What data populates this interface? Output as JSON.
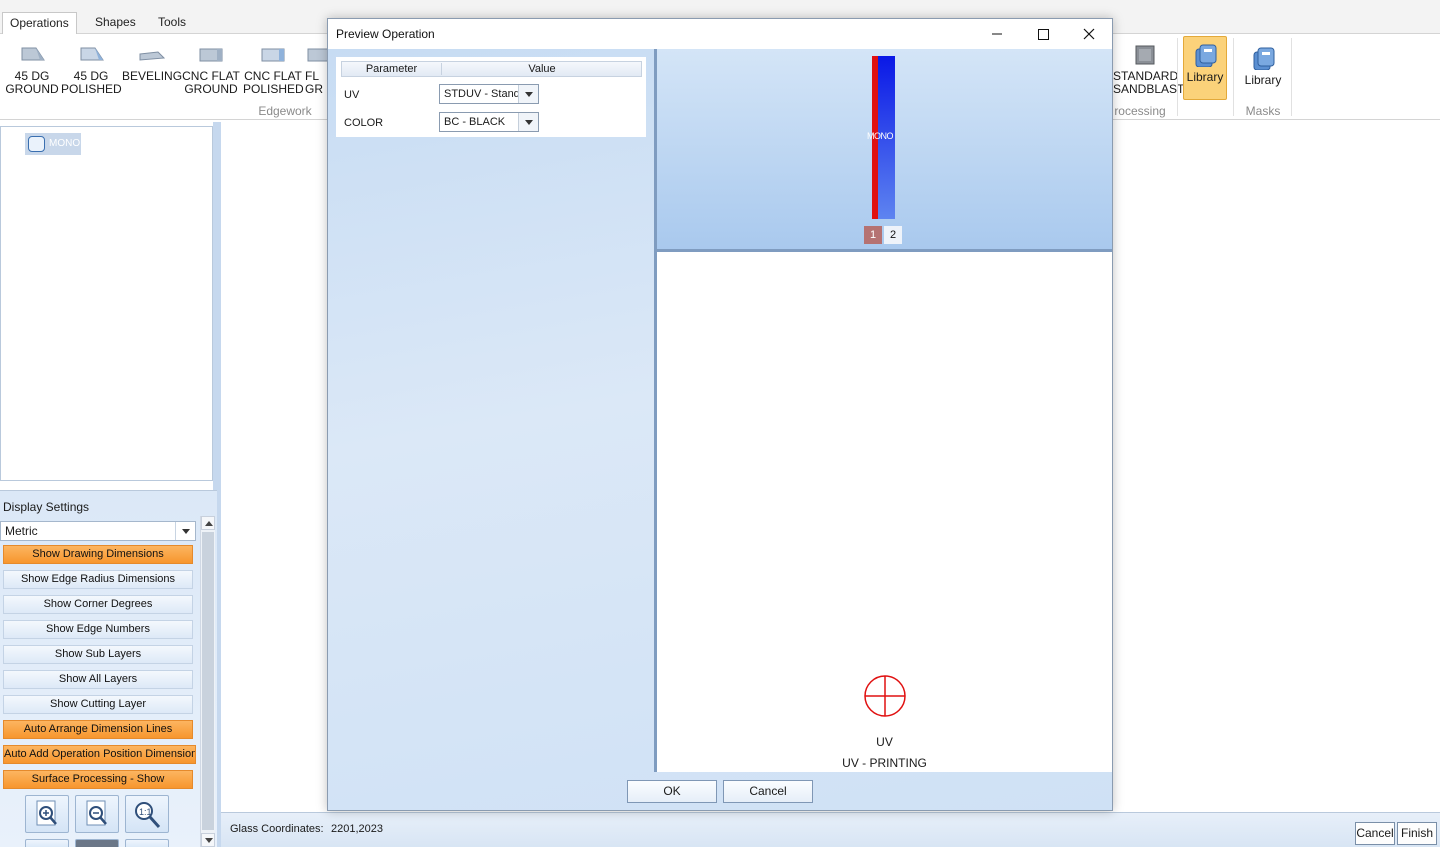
{
  "ribbon": {
    "tabs": [
      {
        "label": "Operations",
        "active": true
      },
      {
        "label": "Shapes",
        "active": false
      },
      {
        "label": "Tools",
        "active": false
      }
    ],
    "buttons": [
      {
        "line1": "45 DG",
        "line2": "GROUND",
        "icon": "edge-45-icon"
      },
      {
        "line1": "45 DG",
        "line2": "POLISHED",
        "icon": "edge-45-polished-icon"
      },
      {
        "line1": "BEVELING",
        "line2": "",
        "icon": "bevel-icon"
      },
      {
        "line1": "CNC FLAT",
        "line2": "GROUND",
        "icon": "cnc-flat-icon"
      },
      {
        "line1": "CNC FLAT",
        "line2": "POLISHED",
        "icon": "cnc-flat-polished-icon"
      },
      {
        "line1": "FL",
        "line2": "GR",
        "icon": "flat-icon"
      }
    ],
    "right_buttons": [
      {
        "line1": "STANDARD",
        "line2": "SANDBLAST",
        "icon": "sandblast-icon"
      },
      {
        "line1": "Library",
        "line2": "",
        "icon": "library-icon",
        "selected": true
      },
      {
        "line1": "Library",
        "line2": "",
        "icon": "library-icon"
      }
    ],
    "groups": {
      "edgework": "Edgework",
      "processing": "rocessing",
      "masks": "Masks"
    }
  },
  "layer_tree": {
    "node_label": "MONO"
  },
  "display_settings": {
    "title": "Display Settings",
    "units": "Metric",
    "toggles": [
      {
        "label": "Show Drawing Dimensions",
        "on": true
      },
      {
        "label": "Show Edge Radius Dimensions",
        "on": false
      },
      {
        "label": "Show Corner Degrees",
        "on": false
      },
      {
        "label": "Show Edge Numbers",
        "on": false
      },
      {
        "label": "Show Sub Layers",
        "on": false
      },
      {
        "label": "Show All Layers",
        "on": false
      },
      {
        "label": "Show Cutting Layer",
        "on": false
      },
      {
        "label": "Auto Arrange Dimension Lines",
        "on": true
      },
      {
        "label": "Auto Add Operation Position Dimension",
        "on": true
      },
      {
        "label": "Surface Processing - Show",
        "on": true
      }
    ],
    "zoom_buttons": [
      "zoom-in-icon",
      "zoom-out-icon",
      "zoom-actual-icon"
    ]
  },
  "status_bar": {
    "coord_label": "Glass Coordinates:",
    "coord_value": "2201,2023",
    "cancel_label": "Cancel",
    "finish_label": "Finish"
  },
  "dialog": {
    "title": "Preview Operation",
    "table_header": {
      "param": "Parameter",
      "value": "Value"
    },
    "rows": [
      {
        "param": "UV",
        "value": "STDUV - Standard"
      },
      {
        "param": "COLOR",
        "value": "BC - BLACK"
      }
    ],
    "bar_label": "MONO",
    "edge_numbers": [
      "1",
      "2"
    ],
    "operation_code": "UV",
    "operation_name": "UV - PRINTING",
    "ok_label": "OK",
    "cancel_label": "Cancel",
    "colors": {
      "edge_red": "#e01010",
      "edge_blue": "#0a18e6",
      "marker": "#e01010"
    }
  }
}
